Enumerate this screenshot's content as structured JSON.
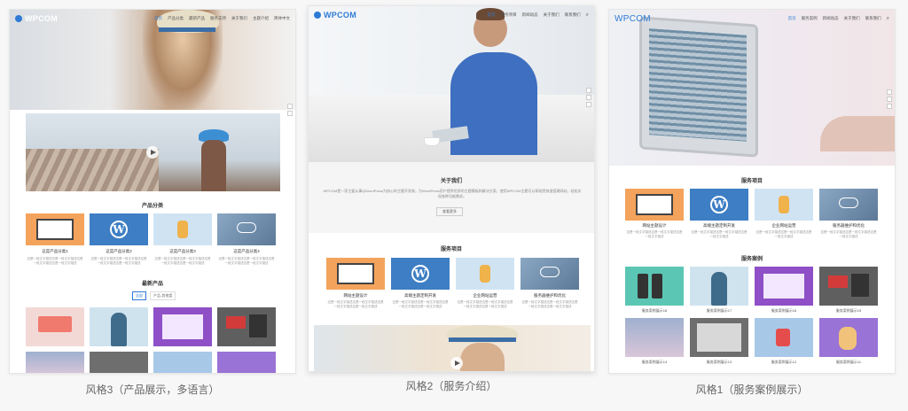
{
  "brand": {
    "logo_text": "WPCOM",
    "accent": "#2e7bd6"
  },
  "style3": {
    "nav": [
      "首页",
      "产品分类",
      "最新产品",
      "服务支持",
      "关于我们",
      "主题介绍",
      "简体中文"
    ],
    "section_categories": "产品分类",
    "categories": [
      "这是产品分类1",
      "这是产品分类2",
      "这是产品分类3",
      "这是产品分类4"
    ],
    "category_desc": "这是一段文字描述这是一段文字描述这是一段文字描述这是一段文字描述",
    "section_latest": "最新产品",
    "latest_tabs": [
      "全部",
      "产品-其他类"
    ],
    "caption": "风格3（产品展示，多语言）"
  },
  "style2": {
    "nav": [
      "首页",
      "服务项目",
      "新闻动态",
      "关于我们",
      "联系我们"
    ],
    "section_about": "关于我们",
    "about_text": "WPCOM是一家主要从事以WordPress为核心的主题开发商，为WordPress用户提供优质的主题模板和解决方案，使用WPCOM主题可以帮助您快速搭建网站，轻松实现各种功能需求。",
    "about_button": "查看更多",
    "section_services": "服务项目",
    "services": [
      "网站主题设计",
      "高端主题定制开发",
      "企业网站运营",
      "服务器维护和优化"
    ],
    "service_desc": "这是一段文字描述这是一段文字描述这是一段文字描述这是一段文字描述",
    "caption": "风格2（服务介绍）"
  },
  "style1": {
    "nav": [
      "首页",
      "服务案例",
      "新闻动态",
      "关于我们",
      "联系我们"
    ],
    "section_services": "服务项目",
    "services": [
      "网站主题设计",
      "高端主题定制开发",
      "企业网站运营",
      "服务器维护和优化"
    ],
    "service_desc": "这是一段文字描述这是一段文字描述这是一段文字描述",
    "section_cases": "服务案例",
    "cases": [
      "服务案例展示18",
      "服务案例展示17",
      "服务案例展示16",
      "服务案例展示15",
      "服务案例展示14",
      "服务案例展示13",
      "服务案例展示12",
      "服务案例展示11"
    ],
    "caption": "风格1（服务案例展示）"
  }
}
